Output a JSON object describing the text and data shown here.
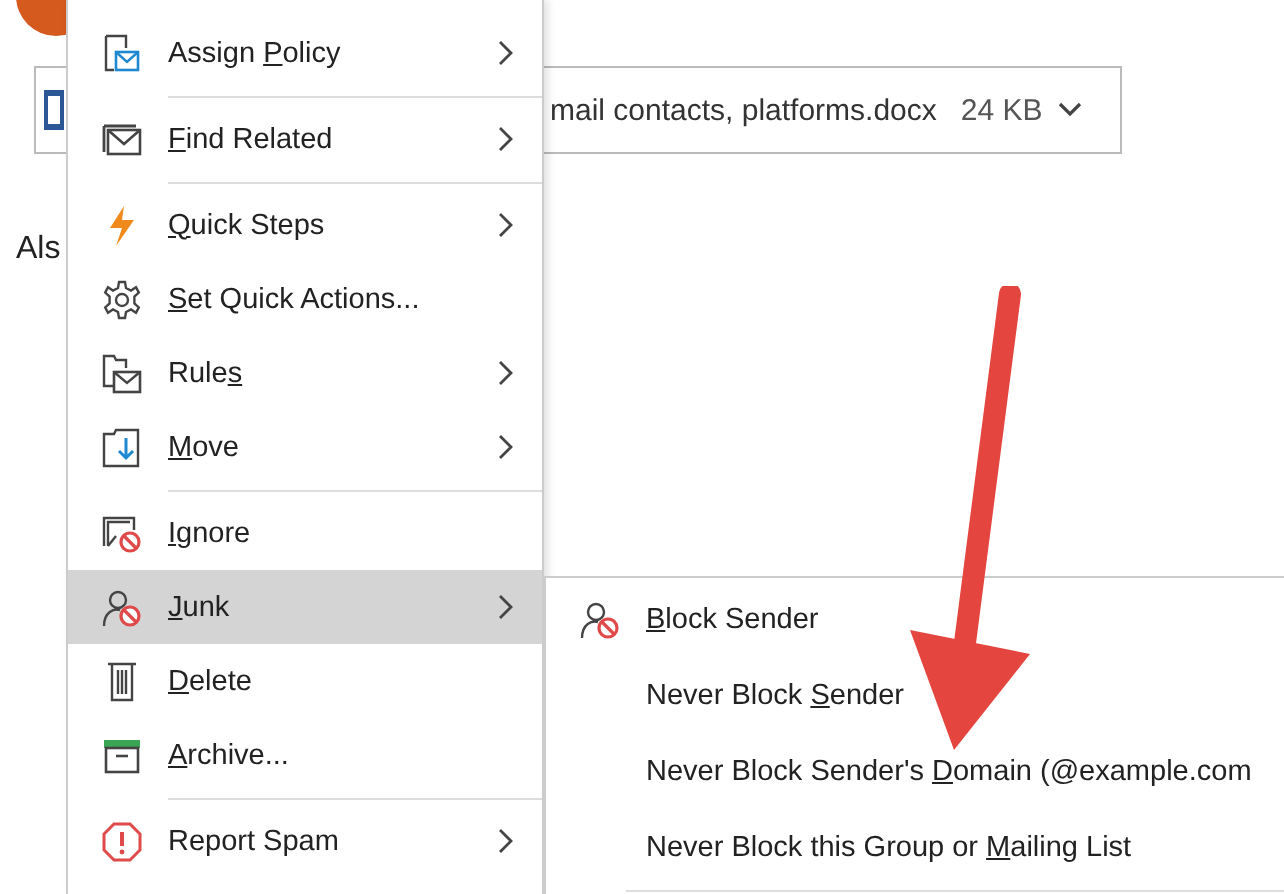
{
  "attachment": {
    "name": "mail contacts, platforms.docx",
    "size": "24 KB"
  },
  "body_text": "Als",
  "menu": [
    {
      "label": {
        "before": "Assign ",
        "key": "P",
        "after": "olicy"
      },
      "submenu": true,
      "selected": false,
      "separator_after": true
    },
    {
      "label": {
        "key": "F",
        "after": "ind Related"
      },
      "submenu": true,
      "selected": false,
      "separator_after": true
    },
    {
      "label": {
        "key": "Q",
        "after": "uick Steps"
      },
      "submenu": true,
      "selected": false,
      "separator_after": false
    },
    {
      "label": {
        "key": "S",
        "after": "et Quick Actions..."
      },
      "submenu": false,
      "selected": false,
      "separator_after": false
    },
    {
      "label": {
        "before": "Rule",
        "key": "s"
      },
      "submenu": true,
      "selected": false,
      "separator_after": false
    },
    {
      "label": {
        "key": "M",
        "after": "ove"
      },
      "submenu": true,
      "selected": false,
      "separator_after": true
    },
    {
      "label": {
        "key": "I",
        "after": "gnore"
      },
      "submenu": false,
      "selected": false,
      "separator_after": false
    },
    {
      "label": {
        "key": "J",
        "after": "unk"
      },
      "submenu": true,
      "selected": true,
      "separator_after": false
    },
    {
      "label": {
        "key": "D",
        "after": "elete"
      },
      "submenu": false,
      "selected": false,
      "separator_after": false
    },
    {
      "label": {
        "key": "A",
        "after": "rchive..."
      },
      "submenu": false,
      "selected": false,
      "separator_after": true
    },
    {
      "label": {
        "before": "Report Spam"
      },
      "submenu": true,
      "selected": false,
      "separator_after": false
    }
  ],
  "junk_submenu": [
    {
      "label": {
        "key": "B",
        "after": "lock Sender"
      }
    },
    {
      "label": {
        "before": "Never Block ",
        "key": "S",
        "after": "ender"
      }
    },
    {
      "label": {
        "before": "Never Block Sender's ",
        "key": "D",
        "after": "omain (@example.com"
      }
    },
    {
      "label": {
        "before": "Never Block this Group or ",
        "key": "M",
        "after": "ailing List"
      }
    }
  ]
}
